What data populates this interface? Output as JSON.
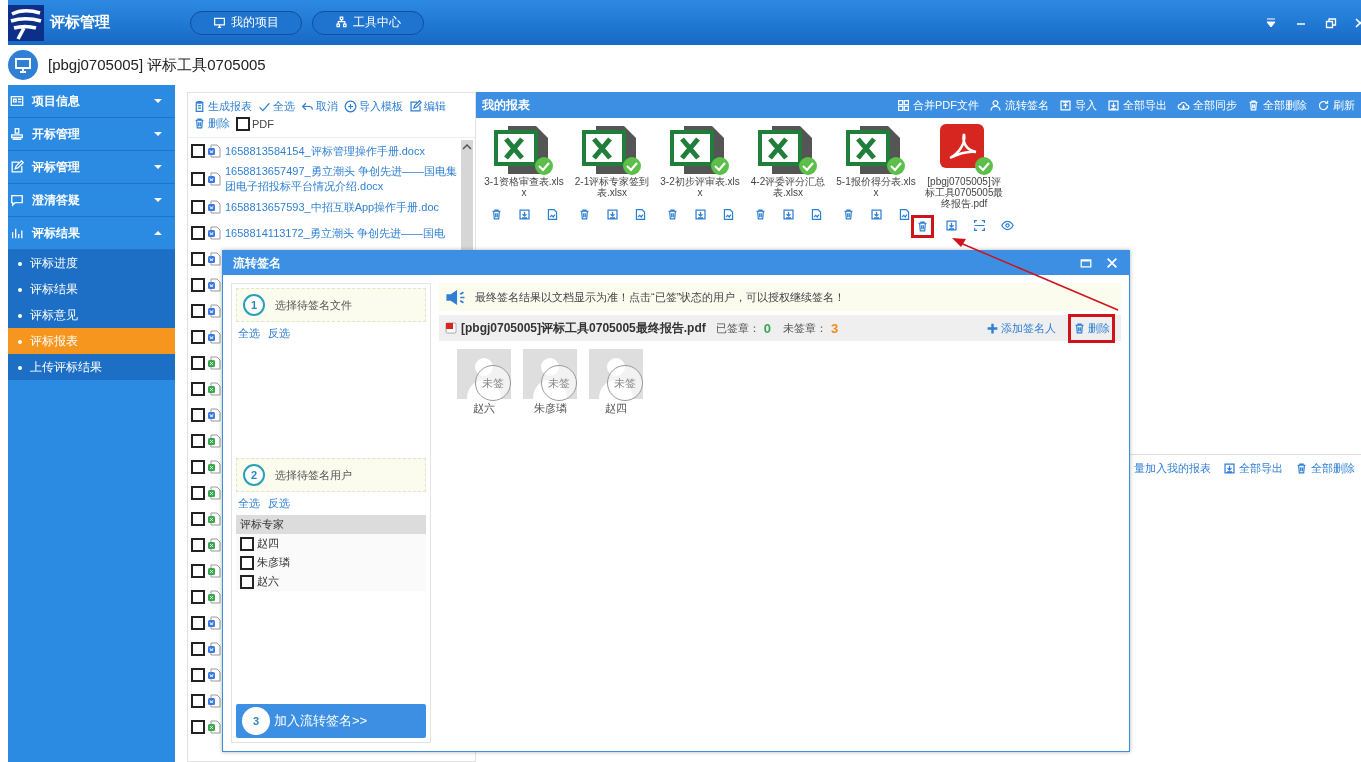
{
  "app": {
    "title": "评标管理",
    "nav": [
      {
        "label": "我的项目"
      },
      {
        "label": "工具中心"
      }
    ]
  },
  "project": {
    "title": "[pbgj0705005] 评标工具0705005"
  },
  "sidebar": {
    "items": [
      {
        "label": "项目信息",
        "expanded": false
      },
      {
        "label": "开标管理",
        "expanded": false
      },
      {
        "label": "评标管理",
        "expanded": false
      },
      {
        "label": "澄清答疑",
        "expanded": false
      },
      {
        "label": "评标结果",
        "expanded": true,
        "children": [
          {
            "label": "评标进度",
            "selected": false
          },
          {
            "label": "评标结果",
            "selected": false
          },
          {
            "label": "评标意见",
            "selected": false
          },
          {
            "label": "评标报表",
            "selected": true
          },
          {
            "label": "上传评标结果",
            "selected": false
          }
        ]
      }
    ]
  },
  "files": {
    "toolbar": [
      {
        "label": "生成报表"
      },
      {
        "label": "全选"
      },
      {
        "label": "取消"
      },
      {
        "label": "导入模板"
      },
      {
        "label": "编辑"
      },
      {
        "label": "删除"
      }
    ],
    "pdf_option": {
      "label": "PDF",
      "checked": false
    },
    "rows": [
      {
        "kind": "word",
        "checked": false,
        "name": "1658813584154_评标管理操作手册.docx"
      },
      {
        "kind": "word",
        "checked": false,
        "name": "1658813657497_勇立潮头 争创先进——国电集团电子招投标平台情况介绍.docx"
      },
      {
        "kind": "word",
        "checked": false,
        "name": "1658813657593_中招互联App操作手册.doc"
      },
      {
        "kind": "word",
        "checked": false,
        "name": "1658814113172_勇立潮头 争创先进——国电"
      },
      {
        "kind": "word",
        "checked": false
      },
      {
        "kind": "word",
        "checked": false
      },
      {
        "kind": "word",
        "checked": false
      },
      {
        "kind": "word",
        "checked": false
      },
      {
        "kind": "excel",
        "checked": false
      },
      {
        "kind": "excel",
        "checked": false
      },
      {
        "kind": "word",
        "checked": false
      },
      {
        "kind": "excel",
        "checked": false
      },
      {
        "kind": "excel",
        "checked": false
      },
      {
        "kind": "excel",
        "checked": false
      },
      {
        "kind": "excel",
        "checked": false
      },
      {
        "kind": "excel",
        "checked": false
      },
      {
        "kind": "excel",
        "checked": false
      },
      {
        "kind": "excel",
        "checked": false
      },
      {
        "kind": "word",
        "checked": false
      },
      {
        "kind": "word",
        "checked": false
      },
      {
        "kind": "word",
        "checked": false
      },
      {
        "kind": "word",
        "checked": false
      },
      {
        "kind": "excel",
        "checked": false
      }
    ]
  },
  "reports": {
    "title": "我的报表",
    "toolbar": [
      {
        "label": "合并PDF文件"
      },
      {
        "label": "流转签名"
      },
      {
        "label": "导入"
      },
      {
        "label": "全部导出"
      },
      {
        "label": "全部同步"
      },
      {
        "label": "全部删除"
      },
      {
        "label": "刷新"
      }
    ],
    "items": [
      {
        "kind": "excel",
        "name": "3-1资格审查表.xlsx",
        "signed": true,
        "annotated": false
      },
      {
        "kind": "excel",
        "name": "2-1评标专家签到表.xlsx",
        "signed": true,
        "annotated": false
      },
      {
        "kind": "excel",
        "name": "3-2初步评审表.xlsx",
        "signed": true,
        "annotated": false
      },
      {
        "kind": "excel",
        "name": "4-2评委评分汇总表.xlsx",
        "signed": true,
        "annotated": false
      },
      {
        "kind": "excel",
        "name": "5-1报价得分表.xlsx",
        "signed": true,
        "annotated": false
      },
      {
        "kind": "pdf",
        "name": "[pbgj0705005]评标工具0705005最终报告.pdf",
        "signed": true,
        "annotated": true
      }
    ],
    "lower_toolbar": [
      {
        "label": "量加入我的报表"
      },
      {
        "label": "全部导出"
      },
      {
        "label": "全部删除"
      }
    ]
  },
  "dialog": {
    "title": "流转签名",
    "step1": {
      "number": "1",
      "label": "选择待签名文件",
      "links": [
        "全选",
        "反选"
      ]
    },
    "step2": {
      "number": "2",
      "label": "选择待签名用户",
      "links": [
        "全选",
        "反选"
      ]
    },
    "group": "评标专家",
    "users": [
      {
        "name": "赵四",
        "checked": false
      },
      {
        "name": "朱彦璘",
        "checked": false
      },
      {
        "name": "赵六",
        "checked": false
      }
    ],
    "submit": {
      "number": "3",
      "label": "加入流转签名>>"
    },
    "notice": "最终签名结果以文档显示为准！点击“已签”状态的用户，可以授权继续签名！",
    "document": {
      "name": "[pbgj0705005]评标工具0705005最终报告.pdf",
      "signed_label": "已签章：",
      "signed_count": "0",
      "unsigned_label": "未签章：",
      "unsigned_count": "3",
      "add_label": "添加签名人",
      "delete_label": "删除",
      "annotated": true
    },
    "signers": [
      {
        "name": "赵六",
        "stamp": "未签"
      },
      {
        "name": "朱彦璘",
        "stamp": "未签"
      },
      {
        "name": "赵四",
        "stamp": "未签"
      }
    ]
  }
}
